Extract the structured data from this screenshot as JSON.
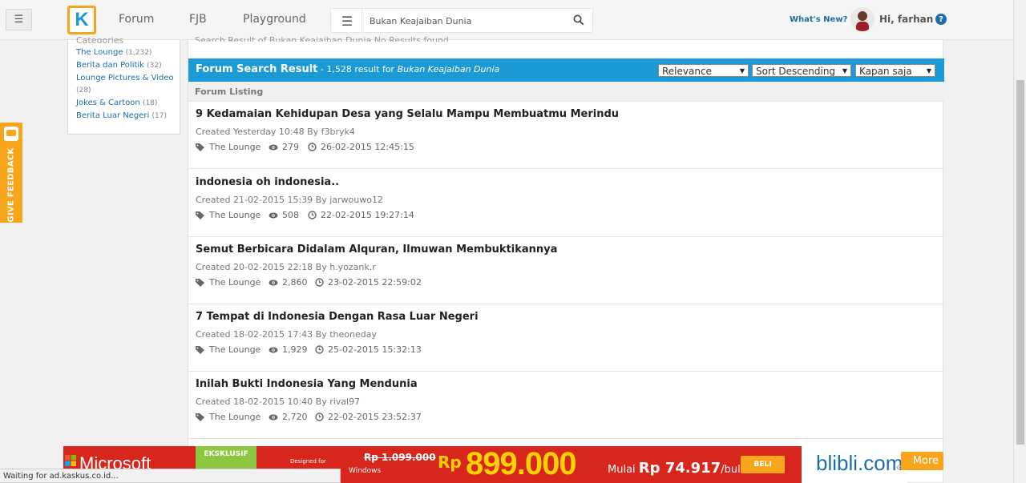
{
  "nav": {
    "links": [
      "Forum",
      "FJB",
      "Playground"
    ],
    "whats_new": "What's New?",
    "greeting": "Hi, farhan",
    "help": "?"
  },
  "search": {
    "value": "Bukan Keajaiban Dunia",
    "placeholder": ""
  },
  "feedback": {
    "label": "GIVE FEEDBACK"
  },
  "categories": {
    "header": "Categories",
    "items": [
      {
        "name": "The Lounge",
        "count": "(1,232)"
      },
      {
        "name": "Berita dan Politik",
        "count": "(32)"
      },
      {
        "name": "Lounge Pictures & Video",
        "count": "(28)"
      },
      {
        "name": "Jokes & Cartoon",
        "count": "(18)"
      },
      {
        "name": "Berita Luar Negeri",
        "count": "(17)"
      }
    ]
  },
  "results": {
    "crumb": "Search Result of Bukan Keajaiban Dunia No Results found",
    "title": "Forum Search Result",
    "subtitle_prefix": " - 1,528 result for ",
    "query": "Bukan Keajaiban Dunia",
    "filters": {
      "relevance": "Relevance",
      "sort": "Sort Descending",
      "time": "Kapan saja"
    },
    "listing_label": "Forum Listing",
    "threads": [
      {
        "title": "9 Kedamaian Kehidupan Desa yang Selalu Mampu Membuatmu Merindu",
        "created": "Created Yesterday 10:48 By f3bryk4",
        "category": "The Lounge",
        "views": "279",
        "last": "26-02-2015 12:45:15"
      },
      {
        "title": "indonesia oh indonesia..",
        "created": "Created 21-02-2015 15:39 By jarwouwo12",
        "category": "The Lounge",
        "views": "508",
        "last": "22-02-2015 19:27:14"
      },
      {
        "title": "Semut Berbicara Didalam Alquran, Ilmuwan Membuktikannya",
        "created": "Created 20-02-2015 22:18 By h.yozank.r",
        "category": "The Lounge",
        "views": "2,860",
        "last": "23-02-2015 22:59:02"
      },
      {
        "title": "7 Tempat di Indonesia Dengan Rasa Luar Negeri",
        "created": "Created 18-02-2015 17:43 By theoneday",
        "category": "The Lounge",
        "views": "1,929",
        "last": "25-02-2015 15:32:13"
      },
      {
        "title": "Inilah Bukti Indonesia Yang Mendunia",
        "created": "Created 18-02-2015 10:40 By rival97",
        "category": "The Lounge",
        "views": "2,720",
        "last": "22-02-2015 23:52:37"
      }
    ]
  },
  "ad": {
    "brand": "Microsoft",
    "exclusive": "EKSKLUSIF",
    "designed_for": "Designed for",
    "windows": "Windows",
    "old_price": "Rp 1.099.000",
    "currency": "Rp",
    "price": "899.000",
    "installment_prefix": "Mulai ",
    "installment": "Rp 74.917",
    "installment_suffix": "/bulan",
    "buy": "BELI",
    "store": "blibli.com"
  },
  "more_label": "More",
  "status_text": "Waiting for ad.kaskus.co.id..."
}
